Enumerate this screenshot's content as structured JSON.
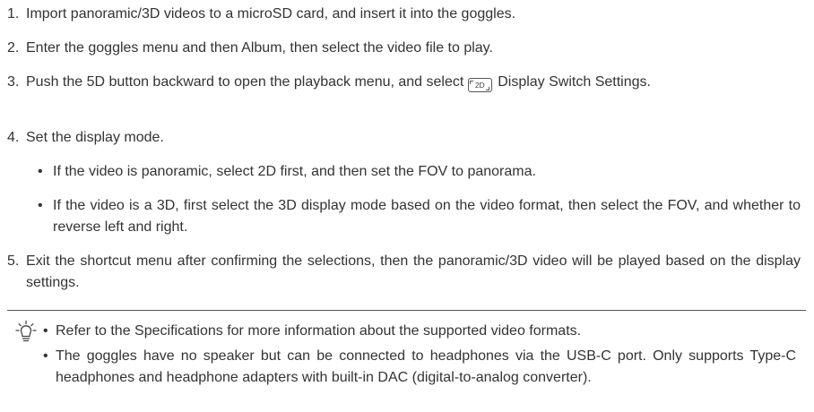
{
  "steps": [
    {
      "num": "1.",
      "text": "Import panoramic/3D videos to a microSD card, and insert it into the goggles."
    },
    {
      "num": "2.",
      "text": "Enter the goggles menu and then Album, then select the video file to play."
    },
    {
      "num": "3.",
      "text_before": "Push the 5D button backward to open the playback menu, and select",
      "icon_label": "2D",
      "text_after": "Display Switch Settings."
    },
    {
      "num": "4.",
      "text": "Set the display mode."
    },
    {
      "num": "5.",
      "text": "Exit the shortcut menu after confirming the selections, then the panoramic/3D video will be played based on the display settings."
    }
  ],
  "display_mode_bullets": [
    {
      "bullet": "•",
      "text": "If the video is panoramic, select 2D first, and then set the FOV to panorama."
    },
    {
      "bullet": "•",
      "text": "If the video is a 3D, first select the 3D display mode based on the video format, then select the FOV, and whether to reverse left and right."
    }
  ],
  "tips": {
    "icon": "lightbulb-icon",
    "items": [
      {
        "bullet": "•",
        "text": "Refer to the Specifications for more information about the supported video formats."
      },
      {
        "bullet": "•",
        "text": "The goggles have no speaker but can be connected to headphones via the USB-C port. Only supports Type-C headphones and headphone adapters with built-in DAC (digital-to-analog converter)."
      }
    ]
  },
  "colors": {
    "text": "#333333",
    "rule": "#555555"
  }
}
